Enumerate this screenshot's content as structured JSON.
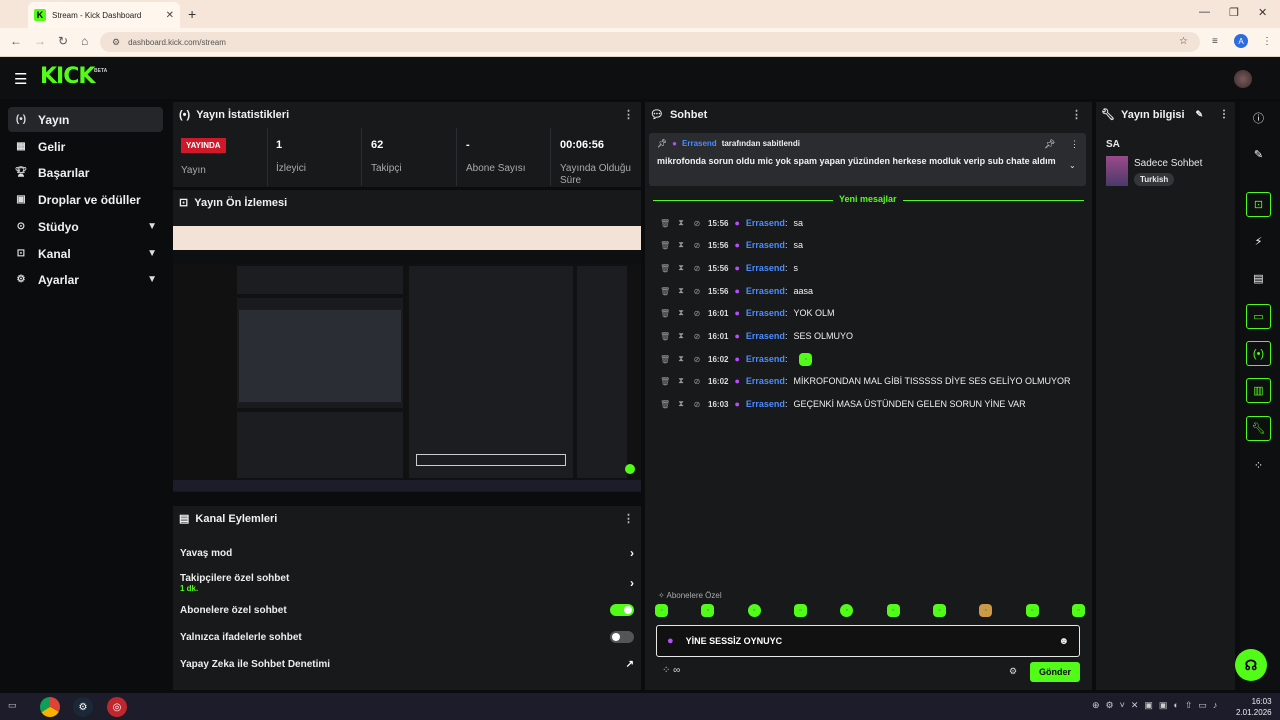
{
  "browser": {
    "tab_title": "Stream - Kick Dashboard",
    "url": "dashboard.kick.com/stream",
    "profile_initial": "A"
  },
  "header": {
    "logo": "KICK",
    "beta": "BETA"
  },
  "sidebar": {
    "items": [
      {
        "label": "Yayın",
        "icon": "broadcast-icon"
      },
      {
        "label": "Gelir",
        "icon": "money-icon"
      },
      {
        "label": "Başarılar",
        "icon": "trophy-icon"
      },
      {
        "label": "Droplar ve ödüller",
        "icon": "gift-icon"
      },
      {
        "label": "Stüdyo",
        "icon": "studio-icon"
      },
      {
        "label": "Kanal",
        "icon": "channel-icon"
      },
      {
        "label": "Ayarlar",
        "icon": "gear-icon"
      }
    ]
  },
  "stats": {
    "title": "Yayın İstatistikleri",
    "live_badge": "YAYINDA",
    "live_label": "Yayın",
    "viewers_value": "1",
    "viewers_label": "İzleyici",
    "followers_value": "62",
    "followers_label": "Takipçi",
    "subs_value": "-",
    "subs_label": "Abone Sayısı",
    "duration_value": "00:06:56",
    "duration_label": "Yayında Olduğu Süre"
  },
  "preview": {
    "title": "Yayın Ön İzlemesi"
  },
  "actions": {
    "title": "Kanal Eylemleri",
    "rows": [
      {
        "label": "Yavaş mod"
      },
      {
        "label": "Takipçilere özel sohbet",
        "sub": "1 dk."
      },
      {
        "label": "Abonelere özel sohbet"
      },
      {
        "label": "Yalnızca ifadelerle sohbet"
      },
      {
        "label": "Yapay Zeka ile Sohbet Denetimi"
      }
    ]
  },
  "chat": {
    "title": "Sohbet",
    "pinned_user": "Errasend",
    "pinned_suffix": "tarafından sabitlendi",
    "pinned_text": "mikrofonda sorun oldu mic yok spam yapan yüzünden herkese modluk verip sub chate aldım",
    "new_messages": "Yeni mesajlar",
    "messages": [
      {
        "time": "15:56",
        "user": "Errasend",
        "text": "sa"
      },
      {
        "time": "15:56",
        "user": "Errasend",
        "text": "sa"
      },
      {
        "time": "15:56",
        "user": "Errasend",
        "text": "s"
      },
      {
        "time": "15:56",
        "user": "Errasend",
        "text": "aasa"
      },
      {
        "time": "16:01",
        "user": "Errasend",
        "text": "YOK OLM"
      },
      {
        "time": "16:01",
        "user": "Errasend",
        "text": "SES OLMUYO"
      },
      {
        "time": "16:02",
        "user": "Errasend",
        "text": ""
      },
      {
        "time": "16:02",
        "user": "Errasend",
        "text": "MİKROFONDAN MAL GİBİ TISSSSS DİYE SES GELİYO OLMUYOR"
      },
      {
        "time": "16:03",
        "user": "Errasend",
        "text": "GEÇENKİ MASA ÜSTÜNDEN GELEN SORUN YİNE VAR"
      }
    ],
    "sub_only_label": "Abonelere Özel",
    "input_value": "YİNE SESSİZ OYNUYC",
    "send_label": "Gönder"
  },
  "info": {
    "title": "Yayın bilgisi",
    "stream_title": "SA",
    "category": "Sadece Sohbet",
    "tag": "Turkish"
  },
  "taskbar": {
    "time": "16:03",
    "date": "2.01.2026"
  },
  "colors": {
    "accent": "#53fc18",
    "live": "#d0182b",
    "username": "#4a8cff"
  }
}
